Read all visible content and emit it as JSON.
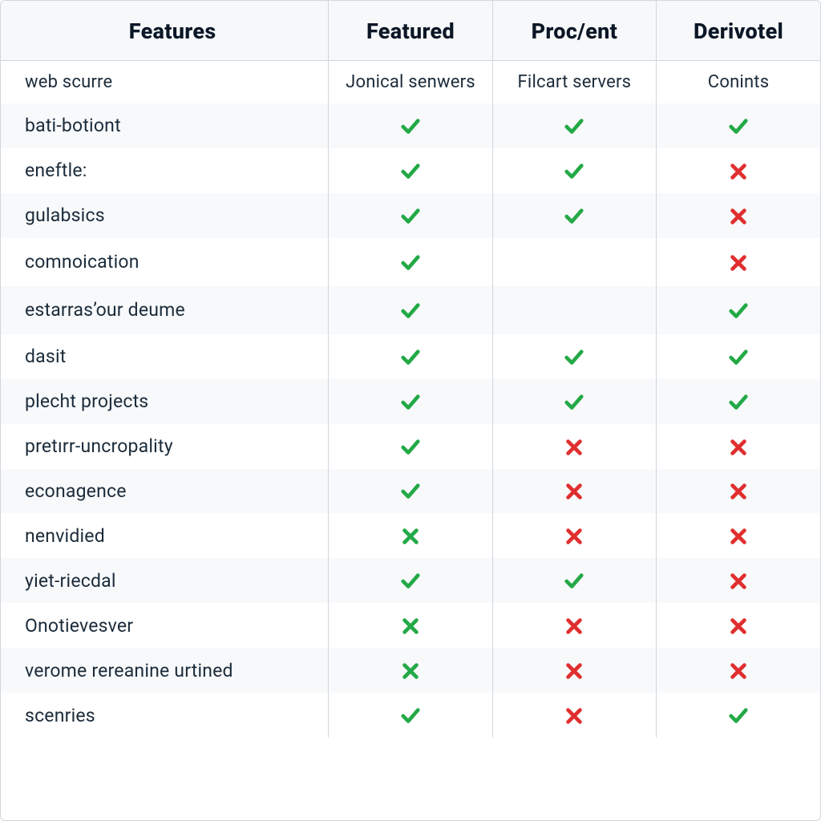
{
  "table": {
    "columns": [
      {
        "label": "Features"
      },
      {
        "label": "Featured"
      },
      {
        "label": "Proc/ent"
      },
      {
        "label": "Derivotel"
      }
    ],
    "subheader": {
      "feature": "web scurre",
      "c1": "Jonical senwers",
      "c2": "Filcart servers",
      "c3": "Conints"
    },
    "rows": [
      {
        "feature": "bati-botiont",
        "c1": "check",
        "c2": "check",
        "c3": "check"
      },
      {
        "feature": "eneftle:",
        "c1": "check",
        "c2": "check",
        "c3": "cross"
      },
      {
        "feature": "gulabsics",
        "c1": "check",
        "c2": "check",
        "c3": "cross"
      },
      {
        "feature": "comnoication",
        "c1": "check",
        "c2": "",
        "c3": "cross"
      },
      {
        "feature": "estarras’our deume",
        "c1": "check",
        "c2": "",
        "c3": "check"
      },
      {
        "feature": "dasit",
        "c1": "check",
        "c2": "check",
        "c3": "check"
      },
      {
        "feature": "plecht projects",
        "c1": "check",
        "c2": "check",
        "c3": "check"
      },
      {
        "feature": "pretırr-uncropality",
        "c1": "check",
        "c2": "cross",
        "c3": "cross"
      },
      {
        "feature": "econagence",
        "c1": "check",
        "c2": "cross",
        "c3": "cross"
      },
      {
        "feature": "nenvidied",
        "c1": "cross-green",
        "c2": "cross",
        "c3": "cross"
      },
      {
        "feature": "yiet-riecdal",
        "c1": "check",
        "c2": "check",
        "c3": "cross"
      },
      {
        "feature": "Onotievesver",
        "c1": "cross-green",
        "c2": "cross",
        "c3": "cross"
      },
      {
        "feature": "verome rereanine urtined",
        "c1": "cross-green",
        "c2": "cross",
        "c3": "cross"
      },
      {
        "feature": "scenries",
        "c1": "check",
        "c2": "cross",
        "c3": "check"
      }
    ]
  },
  "icons": {
    "check": {
      "name": "check-icon",
      "stroke": "#23a946"
    },
    "cross": {
      "name": "cross-icon",
      "stroke": "#e02e2e"
    },
    "cross-green": {
      "name": "cross-icon",
      "stroke": "#23a946"
    }
  }
}
